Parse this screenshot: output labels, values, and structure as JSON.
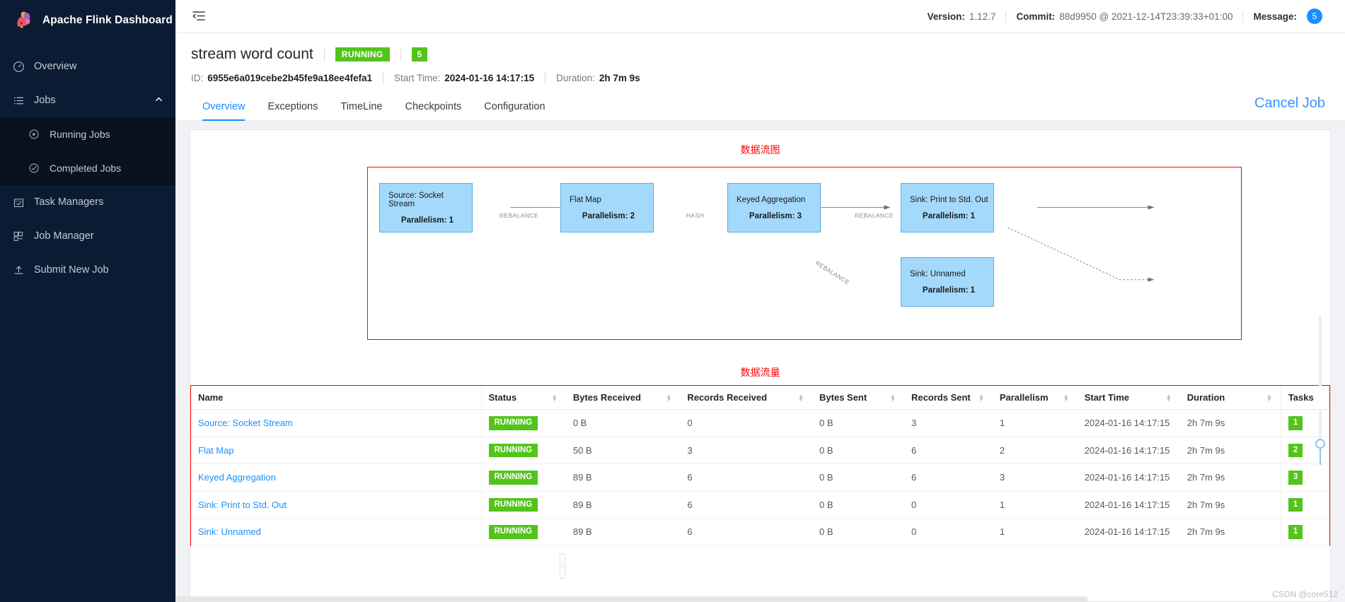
{
  "sidebar": {
    "brand": "Apache Flink Dashboard",
    "items": [
      {
        "label": "Overview",
        "icon": "gauge-icon",
        "id": "overview"
      },
      {
        "label": "Jobs",
        "icon": "list-icon",
        "id": "jobs",
        "expanded": true
      },
      {
        "label": "Running Jobs",
        "icon": "play-circle-icon",
        "id": "running-jobs",
        "sub": true
      },
      {
        "label": "Completed Jobs",
        "icon": "check-circle-icon",
        "id": "completed-jobs",
        "sub": true
      },
      {
        "label": "Task Managers",
        "icon": "calendar-check-icon",
        "id": "task-managers"
      },
      {
        "label": "Job Manager",
        "icon": "cluster-icon",
        "id": "job-manager"
      },
      {
        "label": "Submit New Job",
        "icon": "upload-icon",
        "id": "submit-new-job"
      }
    ]
  },
  "topbar": {
    "collapse_icon": "menu-fold-icon",
    "version_label": "Version:",
    "version_value": "1.12.7",
    "commit_label": "Commit:",
    "commit_value": "88d9950 @ 2021-12-14T23:39:33+01:00",
    "message_label": "Message:",
    "message_count": "5"
  },
  "job": {
    "name": "stream word count",
    "status": "RUNNING",
    "task_count": "5",
    "id_label": "ID:",
    "id_value": "6955e6a019cebe2b45fe9a18ee4fefa1",
    "start_time_label": "Start Time:",
    "start_time_value": "2024-01-16 14:17:15",
    "duration_label": "Duration:",
    "duration_value": "2h 7m 9s",
    "cancel_label": "Cancel Job"
  },
  "tabs": [
    {
      "label": "Overview",
      "active": true
    },
    {
      "label": "Exceptions",
      "active": false
    },
    {
      "label": "TimeLine",
      "active": false
    },
    {
      "label": "Checkpoints",
      "active": false
    },
    {
      "label": "Configuration",
      "active": false
    }
  ],
  "annotations": {
    "graph_title": "数据流图",
    "table_title": "数据流量",
    "watermark": "CSDN @core512",
    "highlight_color": "#ff0000"
  },
  "graph": {
    "nodes": [
      {
        "name": "Source: Socket Stream",
        "parallelism": "Parallelism: 1"
      },
      {
        "name": "Flat Map",
        "parallelism": "Parallelism: 2"
      },
      {
        "name": "Keyed Aggregation",
        "parallelism": "Parallelism: 3"
      },
      {
        "name": "Sink: Print to Std. Out",
        "parallelism": "Parallelism: 1"
      },
      {
        "name": "Sink: Unnamed",
        "parallelism": "Parallelism: 1"
      }
    ],
    "edges": [
      {
        "label": "REBALANCE"
      },
      {
        "label": "HASH"
      },
      {
        "label": "REBALANCE"
      },
      {
        "label": "REBALANCE"
      }
    ],
    "node_fill": "#a4d9fb",
    "node_border": "#5aade0"
  },
  "table": {
    "columns": [
      {
        "label": "Name",
        "sortable": false
      },
      {
        "label": "Status",
        "sortable": true
      },
      {
        "label": "Bytes Received",
        "sortable": true
      },
      {
        "label": "Records Received",
        "sortable": true
      },
      {
        "label": "Bytes Sent",
        "sortable": true
      },
      {
        "label": "Records Sent",
        "sortable": true
      },
      {
        "label": "Parallelism",
        "sortable": true
      },
      {
        "label": "Start Time",
        "sortable": true
      },
      {
        "label": "Duration",
        "sortable": true
      },
      {
        "label": "Tasks",
        "sortable": false
      }
    ],
    "rows": [
      {
        "name": "Source: Socket Stream",
        "status": "RUNNING",
        "bytes_received": "0 B",
        "records_received": "0",
        "bytes_sent": "0 B",
        "records_sent": "3",
        "parallelism": "1",
        "start_time": "2024-01-16 14:17:15",
        "duration": "2h 7m 9s",
        "tasks": "1"
      },
      {
        "name": "Flat Map",
        "status": "RUNNING",
        "bytes_received": "50 B",
        "records_received": "3",
        "bytes_sent": "0 B",
        "records_sent": "6",
        "parallelism": "2",
        "start_time": "2024-01-16 14:17:15",
        "duration": "2h 7m 9s",
        "tasks": "2"
      },
      {
        "name": "Keyed Aggregation",
        "status": "RUNNING",
        "bytes_received": "89 B",
        "records_received": "6",
        "bytes_sent": "0 B",
        "records_sent": "6",
        "parallelism": "3",
        "start_time": "2024-01-16 14:17:15",
        "duration": "2h 7m 9s",
        "tasks": "3"
      },
      {
        "name": "Sink: Print to Std. Out",
        "status": "RUNNING",
        "bytes_received": "89 B",
        "records_received": "6",
        "bytes_sent": "0 B",
        "records_sent": "0",
        "parallelism": "1",
        "start_time": "2024-01-16 14:17:15",
        "duration": "2h 7m 9s",
        "tasks": "1"
      },
      {
        "name": "Sink: Unnamed",
        "status": "RUNNING",
        "bytes_received": "89 B",
        "records_received": "6",
        "bytes_sent": "0 B",
        "records_sent": "0",
        "parallelism": "1",
        "start_time": "2024-01-16 14:17:15",
        "duration": "2h 7m 9s",
        "tasks": "1"
      }
    ]
  }
}
